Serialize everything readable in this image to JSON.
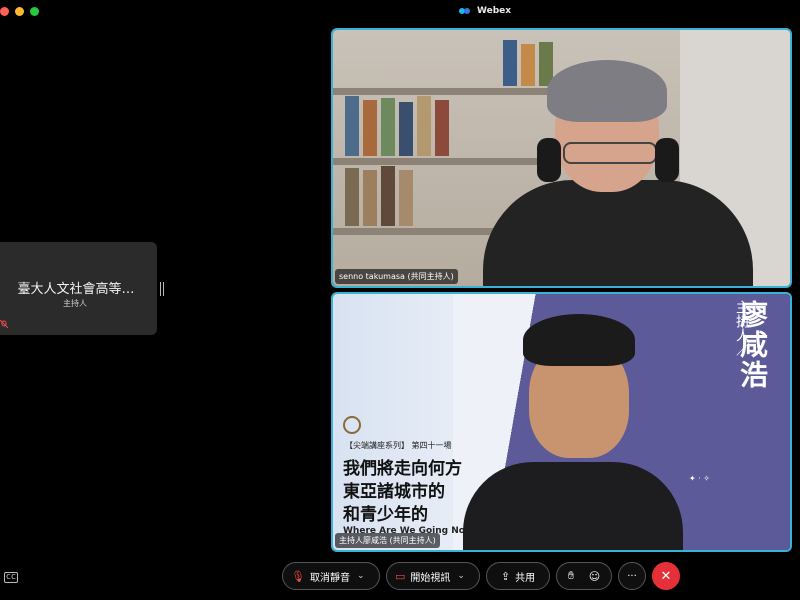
{
  "window": {
    "title": "Webex"
  },
  "participant_card": {
    "name": "臺大人文社會高等…",
    "role": "主持人"
  },
  "tiles": [
    {
      "caption": "senno takumasa (共同主持人)"
    },
    {
      "caption": "主持人廖咸浩 (共同主持人)",
      "poster": {
        "host_label": "主持人／",
        "host_name": "廖咸浩",
        "series": "【尖端講座系列】 第四十一場",
        "line1": "我們將走向何方",
        "line2": "東亞諸城市的",
        "line3": "和青少年的",
        "english": "Where Are We Going No"
      }
    }
  ],
  "controls": {
    "mute_label": "取消靜音",
    "video_label": "開始視訊",
    "share_label": "共用",
    "more_label": "···",
    "leave_label": "✕"
  },
  "colors": {
    "active_speaker_border": "#37b3d7",
    "leave_button": "#e5303a"
  }
}
